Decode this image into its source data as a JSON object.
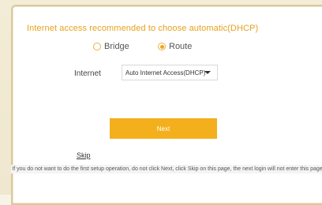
{
  "page": {
    "title": "Internet access recommended to choose automatic(DHCP)"
  },
  "mode": {
    "options": [
      {
        "label": "Bridge",
        "selected": false
      },
      {
        "label": "Route",
        "selected": true
      }
    ]
  },
  "internet": {
    "label": "Internet",
    "selected_value": "Auto Internet Access(DHCP)"
  },
  "actions": {
    "next_label": "Next",
    "skip_label": "Skip"
  },
  "note": {
    "text": "If you do not want to do the first setup operation, do not click Next, click Skip on this page, the next login will not enter this page"
  },
  "colors": {
    "accent": "#f3b01c",
    "title": "#e6a21c"
  }
}
